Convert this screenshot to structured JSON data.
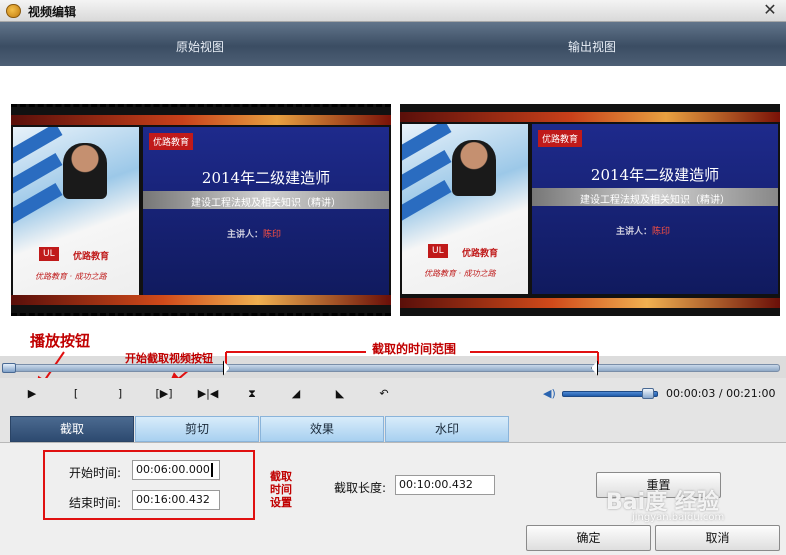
{
  "window": {
    "title": "视频编辑",
    "close_glyph": "✕"
  },
  "view_header": {
    "left_label": "原始视图",
    "right_label": "输出视图"
  },
  "video_slide": {
    "logo": "优路教育",
    "title": "2014年二级建造师",
    "subtitle": "建设工程法规及相关知识（精讲）",
    "speaker_label": "主讲人：",
    "speaker_name": "陈印",
    "panel_logo_box": "UL",
    "panel_logo_text": "优路教育",
    "panel_slogan": "优路教育 · 成功之路"
  },
  "annotations": {
    "play_button": "播放按钮",
    "start_clip_button": "开始截取视频按钮",
    "clip_range": "截取的时间范围",
    "clip_setting": "截取时间设置"
  },
  "timeline": {
    "start_marker_fraction": 0.28,
    "end_marker_fraction": 0.76
  },
  "controls": {
    "buttons": [
      {
        "name": "play-icon",
        "glyph": "▶"
      },
      {
        "name": "mark-in-icon",
        "glyph": "["
      },
      {
        "name": "mark-out-icon",
        "glyph": "]"
      },
      {
        "name": "play-selection-icon",
        "glyph": "[▶]"
      },
      {
        "name": "jump-to-start-icon",
        "glyph": "▶|◀"
      },
      {
        "name": "hourglass-icon",
        "glyph": "⧗"
      },
      {
        "name": "rotate-left-icon",
        "glyph": "◢"
      },
      {
        "name": "rotate-right-icon",
        "glyph": "◣"
      },
      {
        "name": "undo-icon",
        "glyph": "↶"
      }
    ],
    "volume_icon": "speaker-icon",
    "volume_level": 0.9,
    "time_readout": "00:00:03 / 00:21:00"
  },
  "tabs": [
    {
      "label": "截取",
      "active": true
    },
    {
      "label": "剪切",
      "active": false
    },
    {
      "label": "效果",
      "active": false
    },
    {
      "label": "水印",
      "active": false
    }
  ],
  "clip_settings": {
    "start_label": "开始时间:",
    "start_value": "00:06:00.000",
    "end_label": "结束时间:",
    "end_value": "00:16:00.432",
    "length_label": "截取长度:",
    "length_value": "00:10:00.432"
  },
  "buttons": {
    "reset": "重置",
    "ok": "确定",
    "cancel": "取消"
  },
  "watermark": {
    "main": "Bai度 经验",
    "sub": "jingyan.baidu.com"
  },
  "colors": {
    "annotation_red": "#c00000",
    "header_blue": "#3b4d63",
    "active_tab": "#2d4a70",
    "tab_light": "#a8d0f0"
  }
}
